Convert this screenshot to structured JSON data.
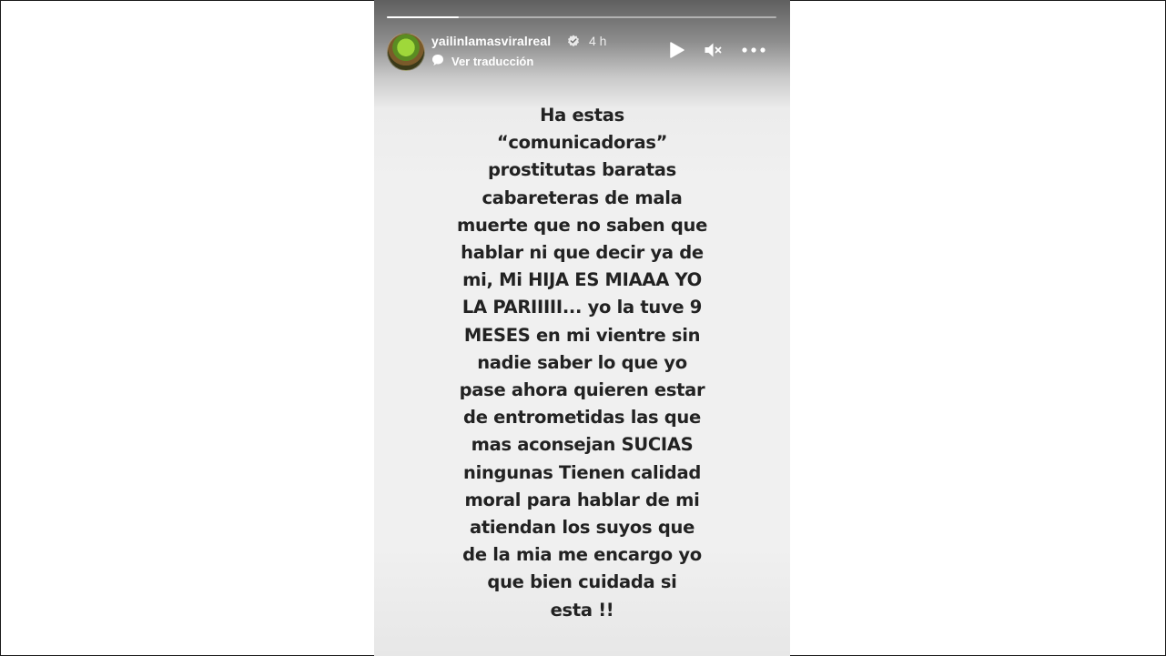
{
  "story": {
    "progress_fraction": 0.185,
    "username": "yailinlamasviralreal",
    "verified_icon": "verified-badge-icon",
    "time_ago": "4 h",
    "translate_label": "Ver traducción",
    "controls": {
      "play_icon": "play-icon",
      "mute_icon": "speaker-muted-icon",
      "more_icon": "more-options-icon"
    },
    "text_lines": [
      "Ha estas",
      "“comunicadoras”",
      "prostitutas baratas",
      "cabareteras de mala",
      "muerte que no saben que",
      "hablar ni que decir ya de",
      "mi, Mi HIJA ES MIAAA YO",
      "LA PARIIIII... yo la tuve 9",
      "MESES en mi vientre sin",
      "nadie saber lo que yo",
      "pase ahora quieren estar",
      "de entrometidas las que",
      "mas aconsejan SUCIAS",
      "ningunas Tienen calidad",
      "moral para hablar de mi",
      "atiendan los suyos que",
      "de la mia me encargo yo",
      "que bien cuidada si",
      "esta !!"
    ]
  }
}
